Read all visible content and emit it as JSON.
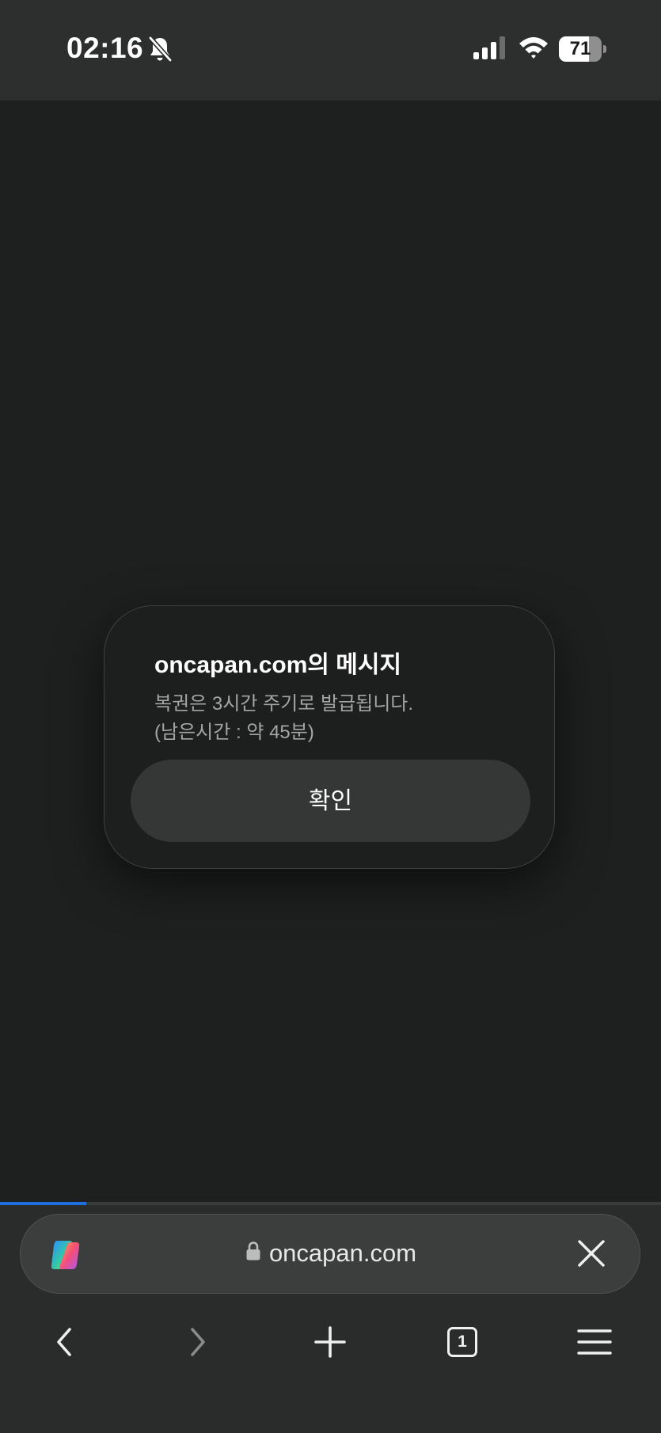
{
  "status_bar": {
    "time": "02:16",
    "battery_level": "71",
    "battery_fraction": 0.71,
    "icons": [
      "bell-off-icon",
      "signal-icon",
      "wifi-icon",
      "battery-icon"
    ]
  },
  "dialog": {
    "title": "oncapan.com의 메시지",
    "message": "복권은 3시간 주기로 발급됩니다.\n(남은시간 : 약 45분)",
    "ok_label": "확인"
  },
  "browser": {
    "page_load_progress": 0.13,
    "address": "oncapan.com",
    "secure": true,
    "tab_count": "1",
    "accent_color": "#1e6fe0",
    "icons": [
      "copilot-icon",
      "lock-icon",
      "close-icon",
      "back-icon",
      "forward-icon",
      "new-tab-icon",
      "tabs-icon",
      "menu-icon"
    ]
  }
}
